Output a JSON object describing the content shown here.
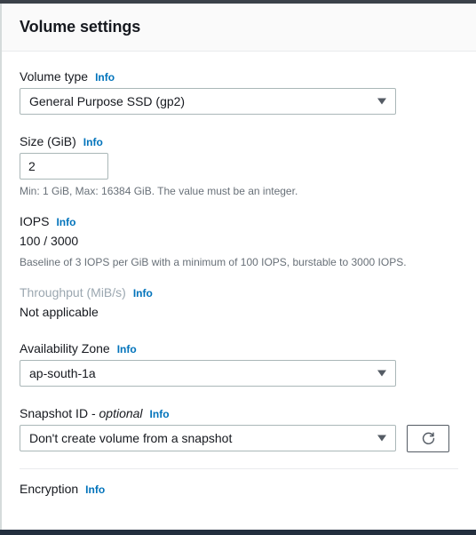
{
  "panel": {
    "title": "Volume settings"
  },
  "info_label": "Info",
  "fields": {
    "volume_type": {
      "label": "Volume type",
      "info": "Info",
      "value": "General Purpose SSD (gp2)",
      "caret": "chevron-down-icon"
    },
    "size": {
      "label": "Size (GiB)",
      "info": "Info",
      "value": "2",
      "placeholder": "",
      "hint": "Min: 1 GiB, Max: 16384 GiB. The value must be an integer."
    },
    "iops": {
      "label": "IOPS",
      "info": "Info",
      "value": "100 / 3000",
      "hint": "Baseline of 3 IOPS per GiB with a minimum of 100 IOPS, burstable to 3000 IOPS."
    },
    "throughput": {
      "label": "Throughput (MiB/s)",
      "info": "Info",
      "value": "Not applicable"
    },
    "availability_zone": {
      "label": "Availability Zone",
      "info": "Info",
      "value": "ap-south-1a",
      "caret": "chevron-down-icon"
    },
    "snapshot_id": {
      "label": "Snapshot ID - ",
      "label_optional": "optional",
      "info": "Info",
      "value": "Don't create volume from a snapshot",
      "caret": "chevron-down-icon",
      "refresh_icon": "refresh-icon"
    },
    "encryption": {
      "label": "Encryption",
      "info": "Info"
    }
  },
  "colors": {
    "link": "#0073bb",
    "text": "#16191f",
    "muted": "#687078",
    "disabled_label": "#9ba7b0",
    "border": "#aab7b8",
    "header_bg": "#fafafa",
    "divider": "#e9ebed",
    "chrome": "#232f3e"
  }
}
